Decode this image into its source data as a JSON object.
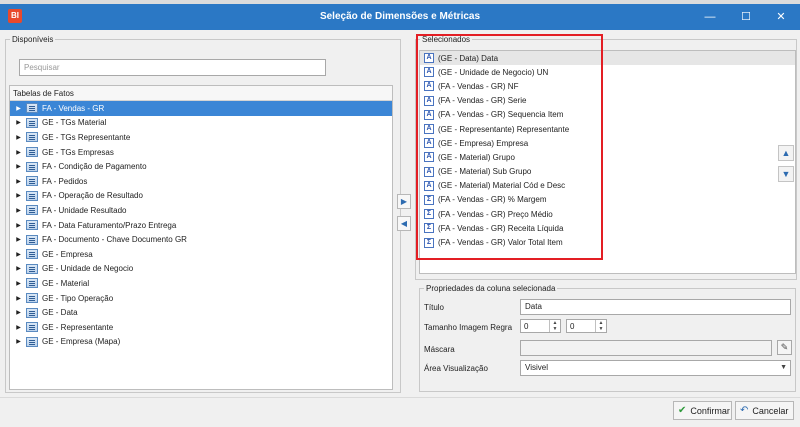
{
  "window": {
    "app_badge": "BI",
    "title": "Seleção de Dimensões e Métricas",
    "minimize": "—",
    "maximize": "☐",
    "close": "✕"
  },
  "disponiveis": {
    "legend": "Disponíveis",
    "search_placeholder": "Pesquisar",
    "tree_header": "Tabelas de Fatos",
    "items": [
      "FA - Vendas - GR",
      "GE - TGs Material",
      "GE - TGs Representante",
      "GE - TGs Empresas",
      "FA - Condição de Pagamento",
      "FA - Pedidos",
      "FA - Operação de Resultado",
      "FA - Unidade Resultado",
      "FA - Data Faturamento/Prazo Entrega",
      "FA - Documento - Chave Documento GR",
      "GE - Empresa",
      "GE - Unidade de Negocio",
      "GE - Material",
      "GE - Tipo Operação",
      "GE - Data",
      "GE - Representante",
      "GE - Empresa (Mapa)"
    ]
  },
  "transfer": {
    "add": "▶",
    "remove": "◀"
  },
  "selecionados": {
    "legend": "Selecionados",
    "items": [
      {
        "tag": "A",
        "label": "(GE - Data) Data"
      },
      {
        "tag": "A",
        "label": "(GE - Unidade de Negocio) UN"
      },
      {
        "tag": "A",
        "label": "(FA - Vendas - GR) NF"
      },
      {
        "tag": "A",
        "label": "(FA - Vendas - GR) Serie"
      },
      {
        "tag": "A",
        "label": "(FA - Vendas - GR) Sequencia Item"
      },
      {
        "tag": "A",
        "label": "(GE - Representante) Representante"
      },
      {
        "tag": "A",
        "label": "(GE - Empresa) Empresa"
      },
      {
        "tag": "A",
        "label": "(GE - Material) Grupo"
      },
      {
        "tag": "A",
        "label": "(GE - Material) Sub Grupo"
      },
      {
        "tag": "A",
        "label": "(GE - Material) Material Cód e Desc"
      },
      {
        "tag": "Σ",
        "label": "(FA - Vendas - GR) % Margem"
      },
      {
        "tag": "Σ",
        "label": "(FA - Vendas - GR) Preço Médio"
      },
      {
        "tag": "Σ",
        "label": "(FA - Vendas - GR) Receita Líquida"
      },
      {
        "tag": "Σ",
        "label": "(FA - Vendas - GR) Valor Total Item"
      }
    ],
    "move_up": "▲",
    "move_down": "▼"
  },
  "propriedades": {
    "legend": "Propriedades da coluna selecionada",
    "titulo_label": "Título",
    "titulo_value": "Data",
    "tamanho_label": "Tamanho Imagem Regra",
    "tamanho_w": "0",
    "tamanho_h": "0",
    "spin_up": "▲",
    "spin_down": "▼",
    "mascara_label": "Máscara",
    "mascara_value": "",
    "mascara_btn": "✎",
    "area_label": "Área Visualização",
    "area_value": "Visivel",
    "dropdown": "▼"
  },
  "footer": {
    "confirm_icon": "✔",
    "confirm": "Confirmar",
    "cancel_icon": "↶",
    "cancel": "Cancelar"
  },
  "colors": {
    "titlebar": "#2b78c5",
    "selection": "#3b86d6",
    "highlight_box": "#e31e24"
  }
}
